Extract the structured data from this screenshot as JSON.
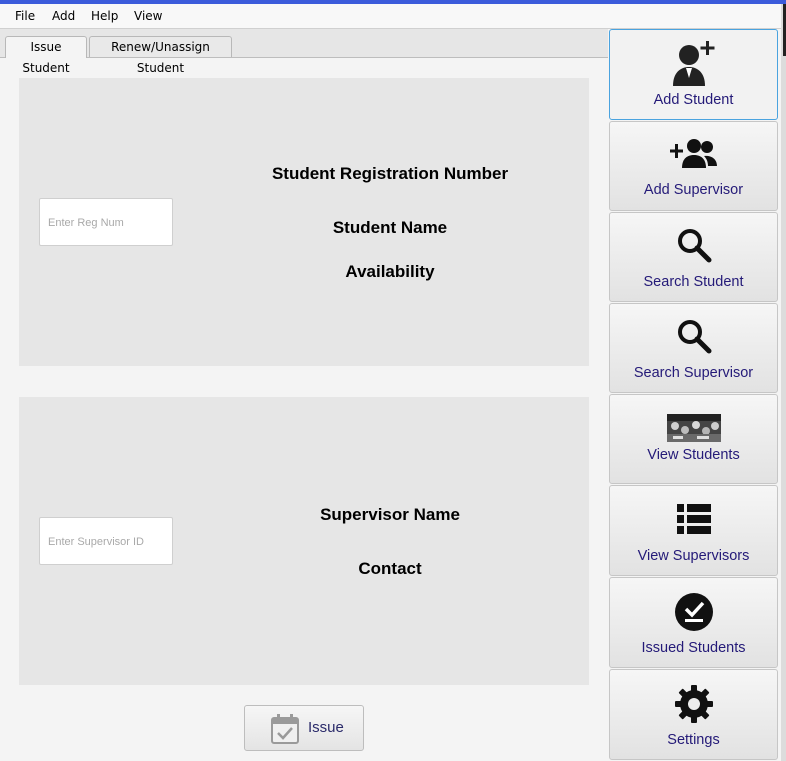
{
  "menu": [
    "File",
    "Add",
    "Help",
    "View"
  ],
  "tabs": [
    "Issue Student",
    "Renew/Unassign Student"
  ],
  "student_panel": {
    "reg_placeholder": "Enter Reg Num",
    "reg_label": "Student Registration Number",
    "name_label": "Student Name",
    "availability_label": "Availability"
  },
  "supervisor_panel": {
    "id_placeholder": "Enter Supervisor ID",
    "name_label": "Supervisor Name",
    "contact_label": "Contact"
  },
  "issue_button": "Issue",
  "sidebar": [
    {
      "label": "Add Student",
      "icon": "add-user-icon"
    },
    {
      "label": "Add Supervisor",
      "icon": "add-group-icon"
    },
    {
      "label": "Search Student",
      "icon": "search-icon"
    },
    {
      "label": "Search Supervisor",
      "icon": "search-icon"
    },
    {
      "label": "View Students",
      "icon": "students-photo-icon"
    },
    {
      "label": "View Supervisors",
      "icon": "list-icon"
    },
    {
      "label": "Issued Students",
      "icon": "check-circle-icon"
    },
    {
      "label": "Settings",
      "icon": "gear-icon"
    }
  ]
}
